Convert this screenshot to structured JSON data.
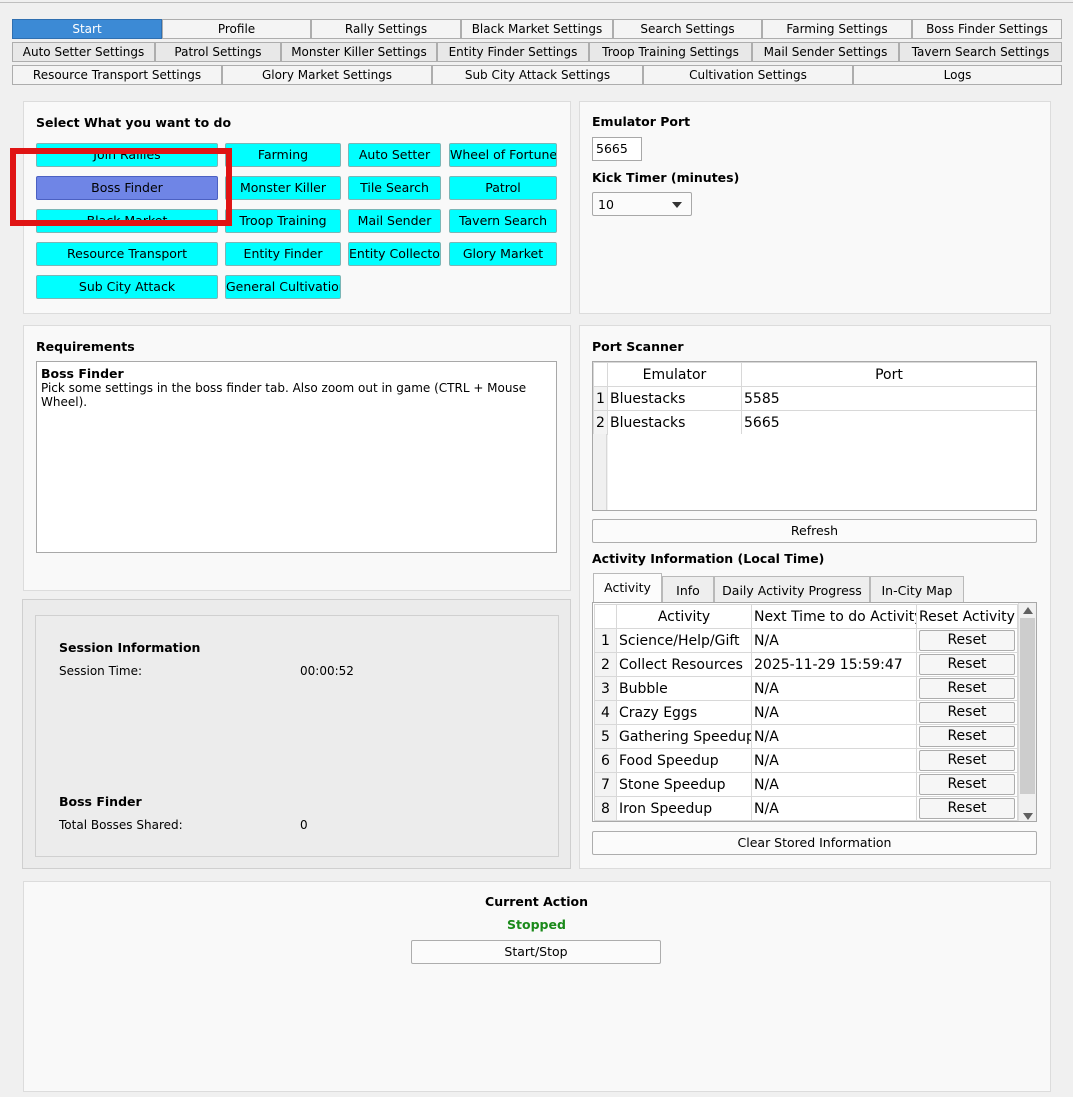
{
  "tabs_row1": [
    "Start",
    "Profile",
    "Rally Settings",
    "Black Market Settings",
    "Search Settings",
    "Farming Settings",
    "Boss Finder Settings"
  ],
  "tabs_row2": [
    "Auto Setter Settings",
    "Patrol Settings",
    "Monster Killer Settings",
    "Entity Finder Settings",
    "Troop Training Settings",
    "Mail Sender Settings",
    "Tavern Search Settings"
  ],
  "tabs_row3": [
    "Resource Transport Settings",
    "Glory Market Settings",
    "Sub City Attack Settings",
    "Cultivation Settings",
    "Logs"
  ],
  "select": {
    "title": "Select What you want to do",
    "buttons": [
      "Join Rallies",
      "Farming",
      "Auto Setter",
      "Wheel of Fortune",
      "Boss Finder",
      "Monster Killer",
      "Tile Search",
      "Patrol",
      "Black Market",
      "Troop Training",
      "Mail Sender",
      "Tavern Search",
      "Resource Transport",
      "Entity Finder",
      "Entity Collector",
      "Glory Market",
      "Sub City Attack",
      "General Cultivation"
    ],
    "selected": "Boss Finder"
  },
  "emulator": {
    "port_label": "Emulator Port",
    "port_value": "5665",
    "kick_label": "Kick Timer (minutes)",
    "kick_value": "10"
  },
  "requirements": {
    "title": "Requirements",
    "heading": "Boss Finder",
    "text": "Pick some settings in the boss finder tab. Also zoom out in game (CTRL + Mouse Wheel)."
  },
  "port_scanner": {
    "title": "Port Scanner",
    "headers": [
      "Emulator",
      "Port"
    ],
    "rows": [
      {
        "num": "1",
        "emulator": "Bluestacks",
        "port": "5585"
      },
      {
        "num": "2",
        "emulator": "Bluestacks",
        "port": "5665"
      }
    ],
    "refresh_label": "Refresh"
  },
  "activity": {
    "title": "Activity Information (Local Time)",
    "tabs": [
      "Activity",
      "Info",
      "Daily Activity Progress",
      "In-City Map"
    ],
    "headers": [
      "Activity",
      "Next Time to do Activity",
      "Reset Activity"
    ],
    "rows": [
      {
        "num": "1",
        "name": "Science/Help/Gift",
        "next": "N/A",
        "reset": "Reset"
      },
      {
        "num": "2",
        "name": "Collect Resources",
        "next": "2025-11-29 15:59:47",
        "reset": "Reset"
      },
      {
        "num": "3",
        "name": "Bubble",
        "next": "N/A",
        "reset": "Reset"
      },
      {
        "num": "4",
        "name": "Crazy Eggs",
        "next": "N/A",
        "reset": "Reset"
      },
      {
        "num": "5",
        "name": "Gathering Speedup",
        "next": "N/A",
        "reset": "Reset"
      },
      {
        "num": "6",
        "name": "Food Speedup",
        "next": "N/A",
        "reset": "Reset"
      },
      {
        "num": "7",
        "name": "Stone Speedup",
        "next": "N/A",
        "reset": "Reset"
      },
      {
        "num": "8",
        "name": "Iron Speedup",
        "next": "N/A",
        "reset": "Reset"
      }
    ],
    "clear_label": "Clear Stored Information"
  },
  "session": {
    "title": "Session Information",
    "time_label": "Session Time:",
    "time_value": "00:00:52",
    "boss_title": "Boss Finder",
    "bosses_label": "Total Bosses Shared:",
    "bosses_value": "0"
  },
  "current_action": {
    "title": "Current Action",
    "status": "Stopped",
    "status_color": "#1a8a1a",
    "button_label": "Start/Stop"
  },
  "colors": {
    "task_button": "#00ffff",
    "task_selected": "#6f85e6",
    "active_tab": "#3c8ad5",
    "highlight_box": "#e01414"
  }
}
